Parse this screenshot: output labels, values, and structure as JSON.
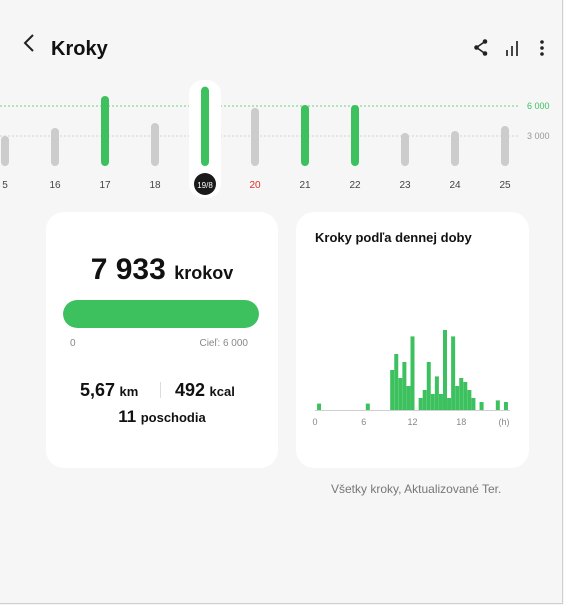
{
  "header": {
    "back_icon": "chevron-left-icon",
    "title": "Kroky",
    "share_icon": "share-icon",
    "chart_toggle_icon": "bar-chart-icon",
    "more_icon": "more-vertical-icon"
  },
  "daily_strip": {
    "goal_label": "6 000",
    "secondary_label": "3 000",
    "days": [
      {
        "label": "5",
        "value": 3000,
        "met": false,
        "selected": false,
        "highlight": false
      },
      {
        "label": "16",
        "value": 3800,
        "met": false,
        "selected": false,
        "highlight": false
      },
      {
        "label": "17",
        "value": 7000,
        "met": true,
        "selected": false,
        "highlight": false
      },
      {
        "label": "18",
        "value": 4300,
        "met": false,
        "selected": false,
        "highlight": false
      },
      {
        "label": "19/8",
        "value": 7933,
        "met": true,
        "selected": true,
        "highlight": false
      },
      {
        "label": "20",
        "value": 5800,
        "met": false,
        "selected": false,
        "highlight": true
      },
      {
        "label": "21",
        "value": 6100,
        "met": true,
        "selected": false,
        "highlight": false
      },
      {
        "label": "22",
        "value": 6100,
        "met": true,
        "selected": false,
        "highlight": false
      },
      {
        "label": "23",
        "value": 3300,
        "met": false,
        "selected": false,
        "highlight": false
      },
      {
        "label": "24",
        "value": 3500,
        "met": false,
        "selected": false,
        "highlight": false
      },
      {
        "label": "25",
        "value": 4000,
        "met": false,
        "selected": false,
        "highlight": false
      }
    ]
  },
  "summary": {
    "steps_value": "7 933",
    "steps_unit": "krokov",
    "progress": 1.0,
    "progress_min": "0",
    "goal_text": "Cieľ: 6 000",
    "distance_value": "5,67",
    "distance_unit": "km",
    "calories_value": "492",
    "calories_unit": "kcal",
    "floors_value": "11",
    "floors_unit": "poschodia"
  },
  "hourly": {
    "title": "Kroky podľa dennej doby",
    "xticks": [
      "0",
      "6",
      "12",
      "18",
      "(h)"
    ]
  },
  "chart_data": {
    "type": "bar",
    "title": "Kroky podľa dennej doby",
    "x": [
      0.5,
      6.5,
      9.5,
      10,
      10.5,
      11,
      11.5,
      12,
      13,
      13.5,
      14,
      14.5,
      15,
      15.5,
      16,
      16.5,
      17,
      17.5,
      18,
      18.5,
      19,
      19.5,
      20.5,
      22.5,
      23.5
    ],
    "values": [
      0.08,
      0.08,
      0.5,
      0.7,
      0.4,
      0.6,
      0.3,
      0.92,
      0.15,
      0.25,
      0.6,
      0.2,
      0.42,
      0.2,
      1.0,
      0.15,
      0.92,
      0.3,
      0.4,
      0.35,
      0.25,
      0.15,
      0.1,
      0.12,
      0.1
    ],
    "xlim": [
      0,
      24
    ],
    "xticks": [
      "0",
      "6",
      "12",
      "18",
      "(h)"
    ]
  },
  "footer": {
    "note": "Všetky kroky, Aktualizované Ter."
  },
  "colors": {
    "accent": "#3cc15e",
    "inactive_bar": "#cccccc",
    "highlight_text": "#d9322a",
    "selected_bg": "#1a1a1a"
  }
}
